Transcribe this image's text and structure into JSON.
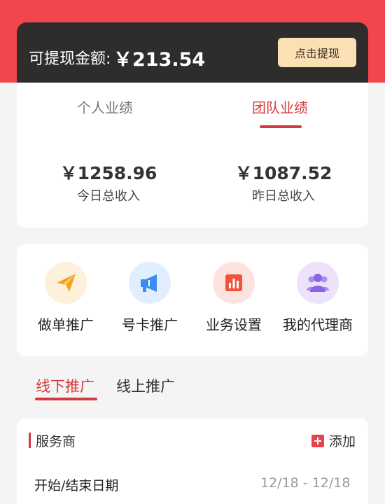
{
  "balance": {
    "label": "可提现金额:",
    "amount": "￥213.54",
    "withdraw_label": "点击提现"
  },
  "performance": {
    "tabs": [
      {
        "label": "个人业绩",
        "active": false
      },
      {
        "label": "团队业绩",
        "active": true
      }
    ],
    "stats": [
      {
        "amount": "￥1258.96",
        "label": "今日总收入"
      },
      {
        "amount": "￥1087.52",
        "label": "昨日总收入"
      }
    ]
  },
  "menu": {
    "items": [
      {
        "label": "做单推广",
        "icon": "paper-plane-icon",
        "color": "#f6a31c"
      },
      {
        "label": "号卡推广",
        "icon": "megaphone-icon",
        "color": "#3b8df5"
      },
      {
        "label": "业务设置",
        "icon": "bar-chart-icon",
        "color": "#f0533a"
      },
      {
        "label": "我的代理商",
        "icon": "group-icon",
        "color": "#8a63e6"
      }
    ]
  },
  "promo_tabs": [
    {
      "label": "线下推广",
      "active": true
    },
    {
      "label": "线上推广",
      "active": false
    }
  ],
  "form": {
    "section_title": "服务商",
    "add_label": "添加",
    "date_label": "开始/结束日期",
    "date_value": "12/18 - 12/18"
  },
  "colors": {
    "brand_red": "#f1464b",
    "accent_red": "#d43a3f",
    "dark_card": "#2f2d2c",
    "withdraw_button": "#fbe0b4"
  }
}
